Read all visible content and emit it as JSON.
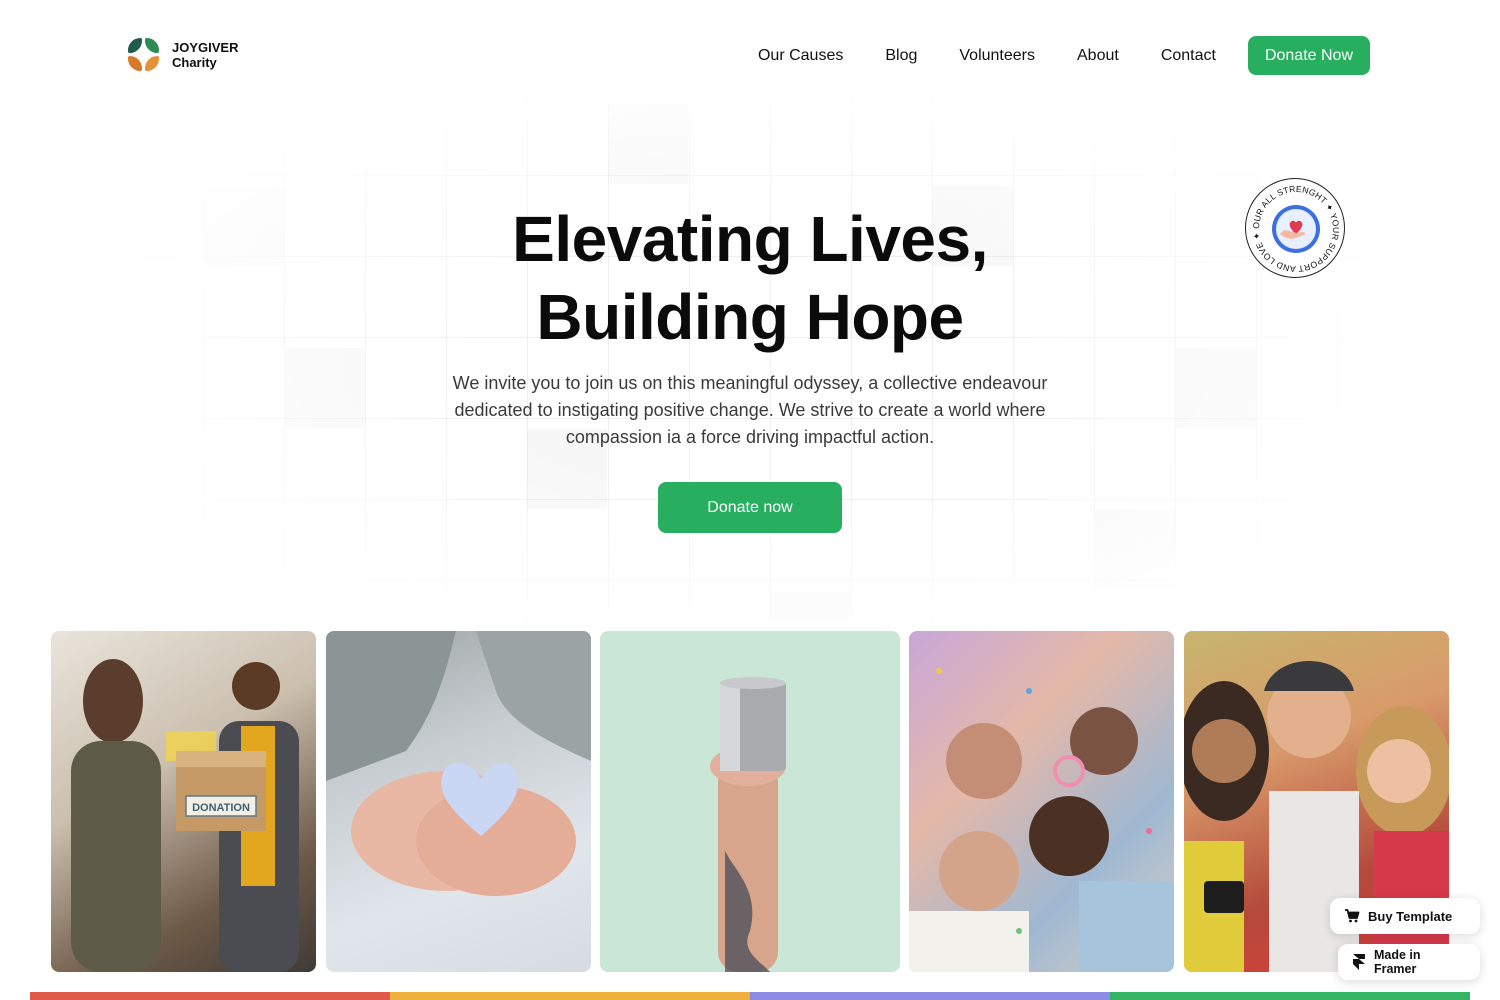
{
  "brand": {
    "line1": "JOYGIVER",
    "line2": "Charity",
    "logo_icon": "clover-leaf-logo"
  },
  "nav": {
    "links": [
      "Our Causes",
      "Blog",
      "Volunteers",
      "About",
      "Contact"
    ],
    "cta": "Donate Now"
  },
  "hero": {
    "title_line1": "Elevating Lives,",
    "title_line2": "Building Hope",
    "subtitle": "We invite you to join us on this meaningful odyssey, a collective endeavour dedicated to instigating positive change. We strive to create a world where compassion ia a force driving impactful action.",
    "cta": "Donate now"
  },
  "badge": {
    "text": "OUR ALL STRENGHT ✦ YOUR SUPPORT AND LOVE ✦",
    "icon": "heart-hands-icon"
  },
  "gallery": [
    {
      "subject": "donation-box-photo",
      "box_label": "DONATION"
    },
    {
      "subject": "hands-holding-heart-photo"
    },
    {
      "subject": "hand-holding-tin-can-photo"
    },
    {
      "subject": "friends-circle-confetti-photo"
    },
    {
      "subject": "friends-group-selfie-photo"
    }
  ],
  "colors": {
    "accent": "#27ae5f",
    "bar": [
      "#e05a4a",
      "#f0b03c",
      "#8d8be6",
      "#35b466"
    ]
  },
  "floating": {
    "buy": "Buy Template",
    "framer": "Made in Framer"
  }
}
